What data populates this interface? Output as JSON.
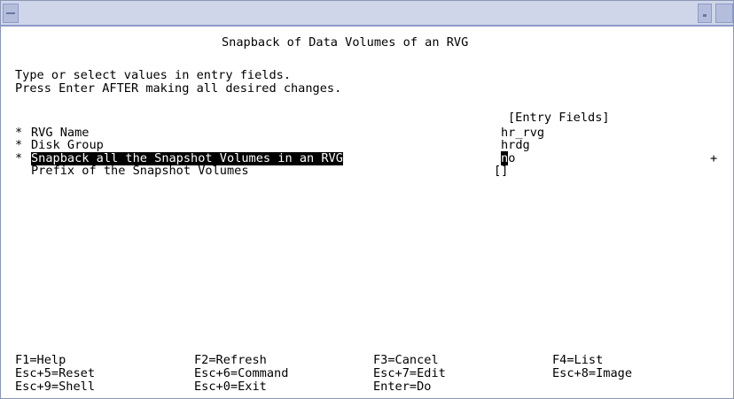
{
  "window": {
    "title": ""
  },
  "form": {
    "title": "Snapback of Data Volumes of an RVG",
    "instructions": [
      "Type or select values in entry fields.",
      "Press Enter AFTER making all desired changes."
    ],
    "entry_fields_header": "[Entry Fields]",
    "fields": [
      {
        "required_marker": "*",
        "label": "RVG Name",
        "value": "hr_rvg"
      },
      {
        "required_marker": "*",
        "label": "Disk Group",
        "value": "hrdg"
      },
      {
        "required_marker": "*",
        "label": "Snapback all the Snapshot Volumes in an RVG",
        "value_cursor_char": "n",
        "value_rest": "o",
        "list_indicator": "+"
      },
      {
        "required_marker": "",
        "label": "Prefix of the Snapshot Volumes",
        "value": "[]"
      }
    ]
  },
  "function_keys": [
    [
      "F1=Help",
      "F2=Refresh",
      "F3=Cancel",
      "F4=List"
    ],
    [
      "Esc+5=Reset",
      "Esc+6=Command",
      "Esc+7=Edit",
      "Esc+8=Image"
    ],
    [
      "Esc+9=Shell",
      "Esc+0=Exit",
      "Enter=Do",
      ""
    ]
  ]
}
